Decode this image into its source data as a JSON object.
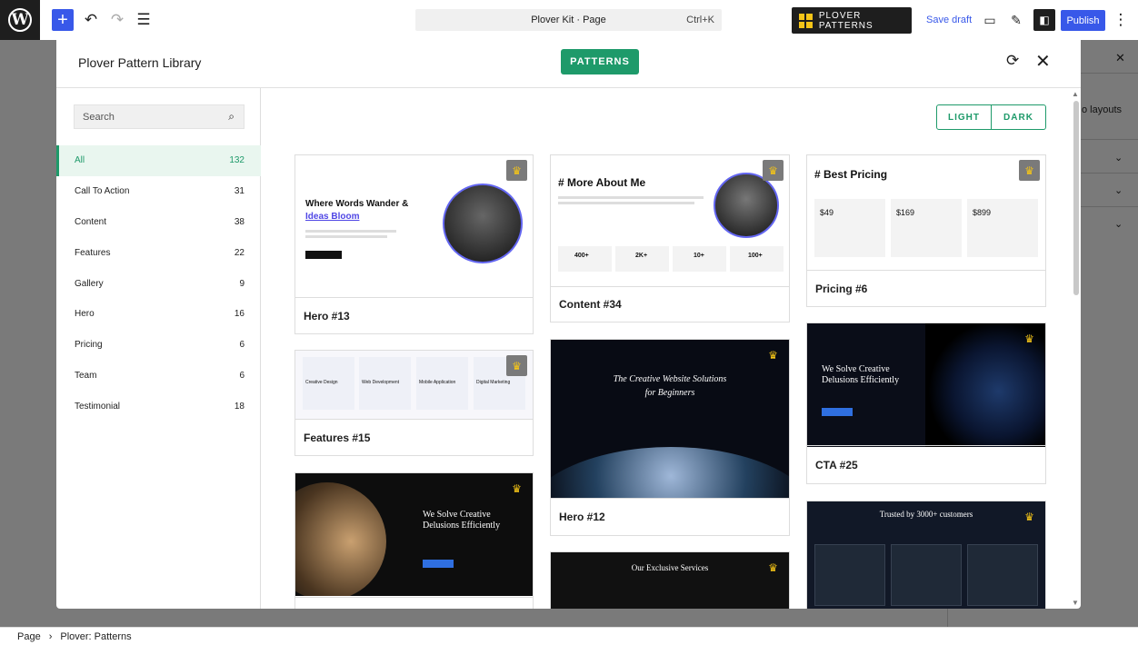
{
  "topbar": {
    "doc_title": "Plover Kit · Page",
    "shortcut": "Ctrl+K",
    "plover_button": "PLOVER PATTERNS",
    "save_draft": "Save draft",
    "publish": "Publish"
  },
  "sidebar": {
    "partial_text": "o layouts"
  },
  "modal": {
    "title": "Plover Pattern Library",
    "tab": "PATTERNS",
    "search_placeholder": "Search",
    "categories": [
      {
        "label": "All",
        "count": "132"
      },
      {
        "label": "Call To Action",
        "count": "31"
      },
      {
        "label": "Content",
        "count": "38"
      },
      {
        "label": "Features",
        "count": "22"
      },
      {
        "label": "Gallery",
        "count": "9"
      },
      {
        "label": "Hero",
        "count": "16"
      },
      {
        "label": "Pricing",
        "count": "6"
      },
      {
        "label": "Team",
        "count": "6"
      },
      {
        "label": "Testimonial",
        "count": "18"
      }
    ],
    "theme_toggle": {
      "light": "LIGHT",
      "dark": "DARK"
    },
    "cards": [
      {
        "label": "Hero #13",
        "heading": "Where Words Wander &",
        "heading2": "Ideas Bloom"
      },
      {
        "label": "Content #34",
        "heading": "# More About Me"
      },
      {
        "label": "Pricing #6",
        "heading": "# Best Pricing",
        "prices": [
          "$49",
          "$169",
          "$899"
        ]
      },
      {
        "label": "Features #15",
        "items": [
          "Creative Design",
          "Web Development",
          "Mobile Application",
          "Digital Marketing"
        ]
      },
      {
        "label": "Hero #12",
        "heading": "The Creative Website Solutions",
        "heading2": "for Beginners"
      },
      {
        "label": "CTA #25",
        "heading": "We Solve Creative",
        "heading2": "Delusions Efficiently"
      },
      {
        "label": "",
        "heading": "We Solve Creative",
        "heading2": "Delusions Efficiently"
      },
      {
        "label": "",
        "heading": "Our Exclusive Services"
      },
      {
        "label": "",
        "heading": "Trusted by 3000+ customers"
      }
    ],
    "stats": [
      "400+",
      "2K+",
      "10+",
      "100+"
    ]
  },
  "footer": {
    "crumb1": "Page",
    "crumb2": "Plover: Patterns"
  },
  "colors": {
    "accent": "#1e9a6a",
    "wp_blue": "#3858e9",
    "crown": "#f5c518"
  }
}
